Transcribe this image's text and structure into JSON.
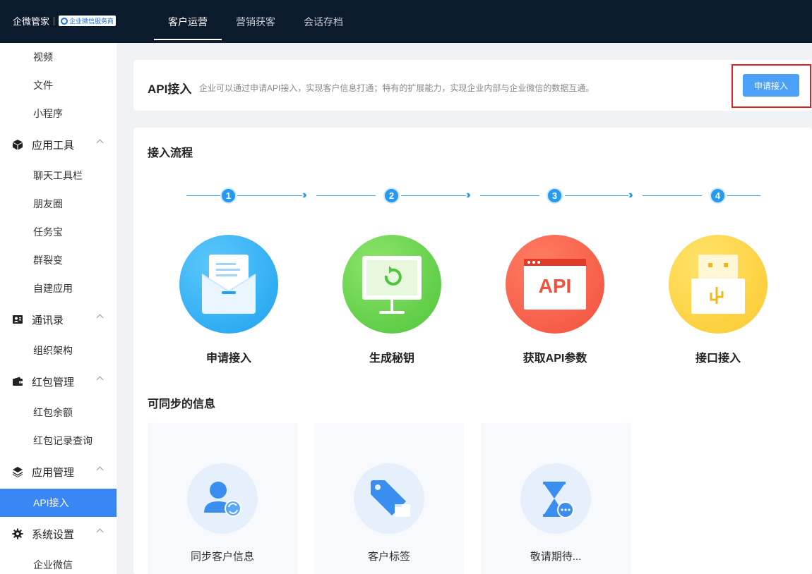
{
  "topbar": {
    "brand": "企微管家",
    "badge": "企业微信服务商",
    "nav": [
      {
        "label": "客户运营",
        "active": true
      },
      {
        "label": "营销获客",
        "active": false
      },
      {
        "label": "会话存档",
        "active": false
      }
    ]
  },
  "sidebar": {
    "video": "视频",
    "file": "文件",
    "mini": "小程序",
    "app_tools": "应用工具",
    "chat_toolbar": "聊天工具栏",
    "moments": "朋友圈",
    "task": "任务宝",
    "fission": "群裂变",
    "custom_app": "自建应用",
    "contacts": "通讯录",
    "org": "组织架构",
    "redpacket": "红包管理",
    "balance": "红包余额",
    "records": "红包记录查询",
    "app_mgmt": "应用管理",
    "api": "API接入",
    "settings": "系统设置",
    "wecom": "企业微信"
  },
  "header": {
    "title": "API接入",
    "desc": "企业可以通过申请API接入，实现客户信息打通；特有的扩展能力，实现企业内部与企业微信的数据互通。",
    "apply_button": "申请接入"
  },
  "process": {
    "title": "接入流程",
    "steps": [
      {
        "num": "1",
        "label": "申请接入"
      },
      {
        "num": "2",
        "label": "生成秘钥"
      },
      {
        "num": "3",
        "label": "获取API参数"
      },
      {
        "num": "4",
        "label": "接口接入"
      }
    ],
    "api_text": "API"
  },
  "sync": {
    "title": "可同步的信息",
    "items": [
      {
        "label": "同步客户信息"
      },
      {
        "label": "客户标签"
      },
      {
        "label": "敬请期待..."
      }
    ]
  },
  "colors": {
    "topbar": "#0c1a2e",
    "accent": "#3a86f5",
    "step_blue": "#259af0",
    "highlight": "#e0201e"
  }
}
